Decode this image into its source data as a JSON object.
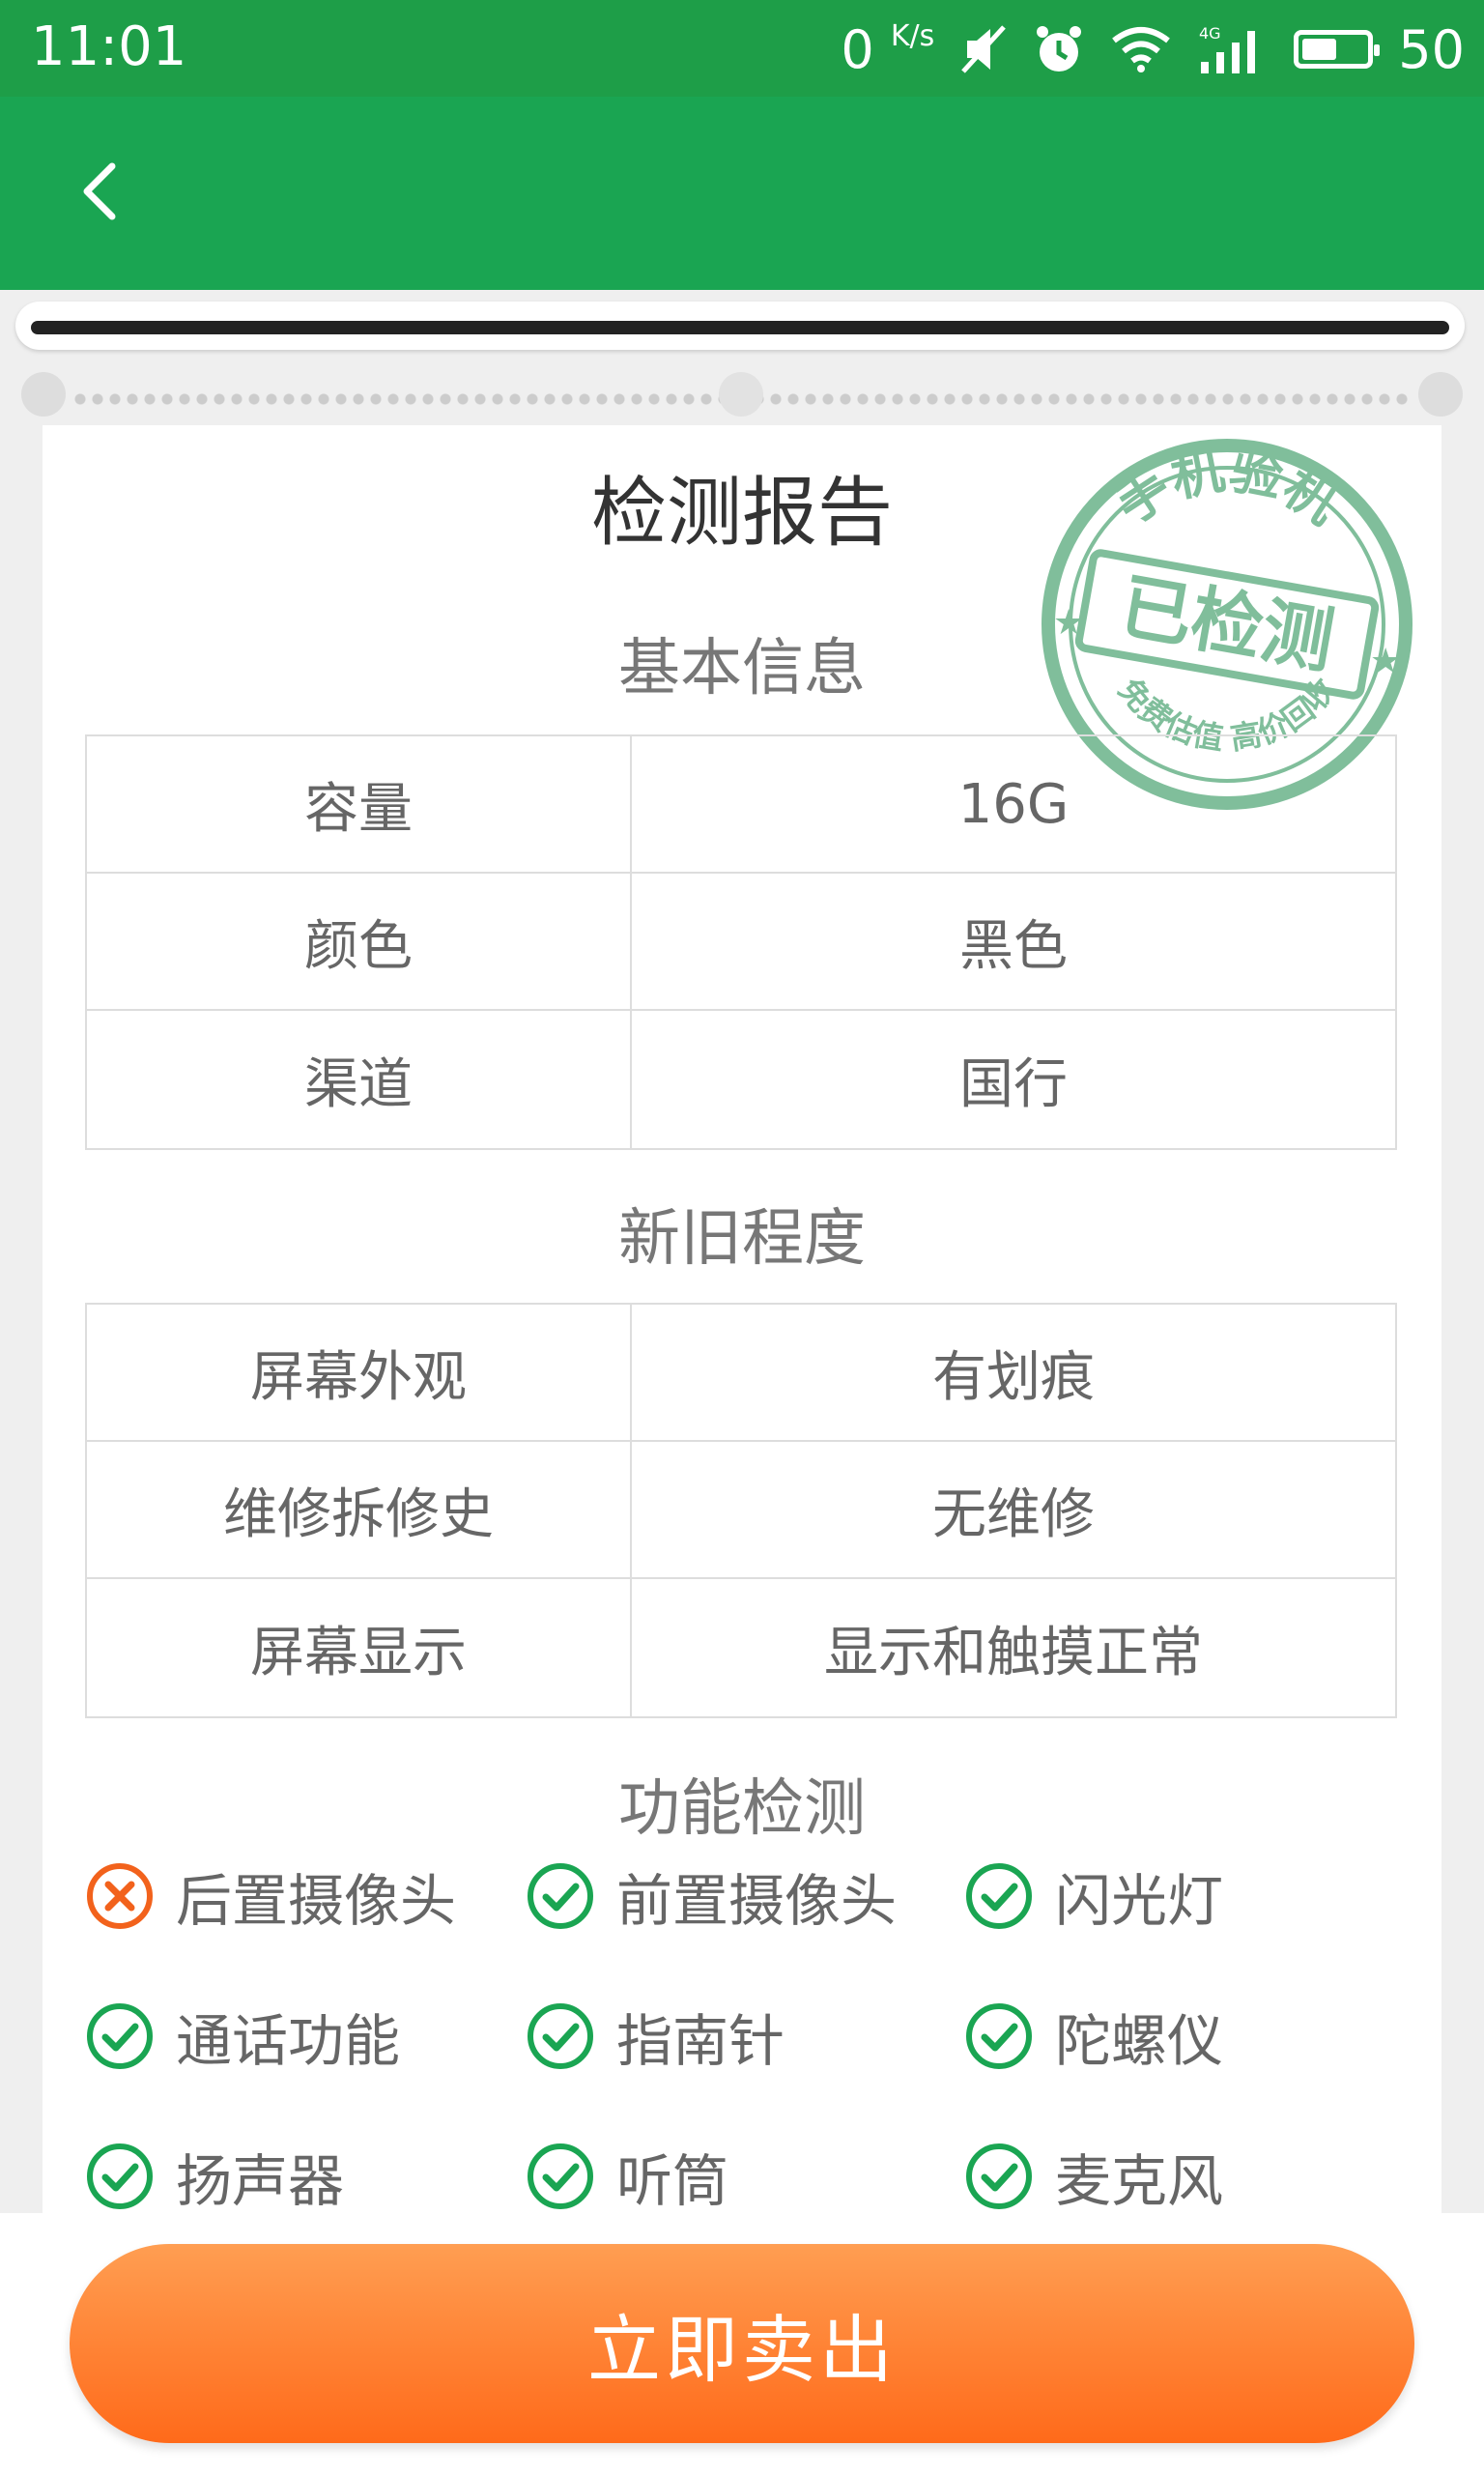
{
  "status_bar": {
    "time": "11:01",
    "net_speed": "0",
    "net_speed_unit": "K/s",
    "battery": "50"
  },
  "report": {
    "title": "检测报告"
  },
  "basic_info": {
    "title": "基本信息",
    "rows": [
      {
        "label": "容量",
        "value": "16G"
      },
      {
        "label": "颜色",
        "value": "黑色"
      },
      {
        "label": "渠道",
        "value": "国行"
      }
    ]
  },
  "condition": {
    "title": "新旧程度",
    "rows": [
      {
        "label": "屏幕外观",
        "value": "有划痕"
      },
      {
        "label": "维修拆修史",
        "value": "无维修"
      },
      {
        "label": "屏幕显示",
        "value": "显示和触摸正常"
      }
    ]
  },
  "functions": {
    "title": "功能检测",
    "items": [
      {
        "label": "后置摄像头",
        "status": "fail"
      },
      {
        "label": "前置摄像头",
        "status": "pass"
      },
      {
        "label": "闪光灯",
        "status": "pass"
      },
      {
        "label": "通话功能",
        "status": "pass"
      },
      {
        "label": "指南针",
        "status": "pass"
      },
      {
        "label": "陀螺仪",
        "status": "pass"
      },
      {
        "label": "扬声器",
        "status": "pass"
      },
      {
        "label": "听筒",
        "status": "pass"
      },
      {
        "label": "麦克风",
        "status": "pass"
      }
    ]
  },
  "stamp": {
    "top_text": "手机验机",
    "center_text": "已检测",
    "bottom_text": "免费估值 高价回收"
  },
  "actions": {
    "sell_label": "立即卖出"
  },
  "colors": {
    "primary_green": "#1aa552",
    "pass_green": "#1aa552",
    "fail_orange": "#f2621c",
    "button_orange": "#ff7a2a"
  }
}
